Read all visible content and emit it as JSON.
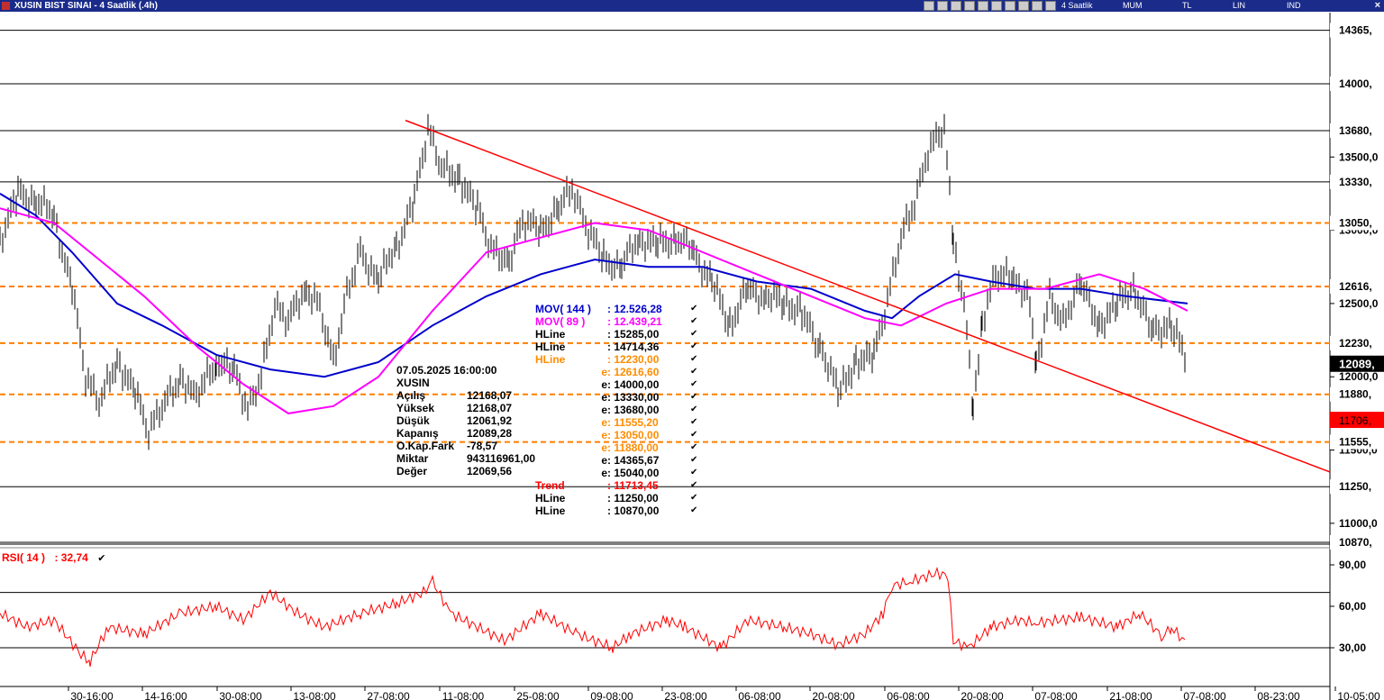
{
  "window": {
    "title": "XUSIN BIST SINAI - 4 Saatlik (.4h)",
    "toolbar_modes": [
      "4 Saatlik",
      "MUM",
      "TL",
      "LIN",
      "IND"
    ],
    "close_glyph": "×"
  },
  "price_axis": {
    "ticks": [
      "13500,0",
      "13000,0",
      "12500,0",
      "12000,0",
      "11500,0",
      "11000,0"
    ],
    "hline_labels": [
      {
        "text": "14365,",
        "value": 14365,
        "color": "#000000",
        "style": "solid"
      },
      {
        "text": "14000,",
        "value": 14000,
        "color": "#000000",
        "style": "solid"
      },
      {
        "text": "13680,",
        "value": 13680,
        "color": "#000000",
        "style": "solid"
      },
      {
        "text": "13330,",
        "value": 13330,
        "color": "#000000",
        "style": "solid"
      },
      {
        "text": "13050,",
        "value": 13050,
        "color": "#ff7f00",
        "style": "dashed"
      },
      {
        "text": "12616,",
        "value": 12616,
        "color": "#ff7f00",
        "style": "dashed"
      },
      {
        "text": "12230,",
        "value": 12230,
        "color": "#ff7f00",
        "style": "dashed"
      },
      {
        "text": "11880,",
        "value": 11880,
        "color": "#ff7f00",
        "style": "dashed"
      },
      {
        "text": "11555,",
        "value": 11555,
        "color": "#ff7f00",
        "style": "dashed"
      },
      {
        "text": "11250,",
        "value": 11250,
        "color": "#000000",
        "style": "solid"
      },
      {
        "text": "10870,",
        "value": 10870,
        "color": "#000000",
        "style": "solid"
      }
    ],
    "last_price": {
      "text": "12089,",
      "value": 12089
    },
    "trend_price": {
      "text": "11706,",
      "value": 11706
    }
  },
  "rsi_axis": {
    "ticks": [
      "90,00",
      "60,00",
      "30,00"
    ]
  },
  "time_axis": [
    "30-16:00",
    "14-16:00",
    "30-08:00",
    "13-08:00",
    "27-08:00",
    "11-08:00",
    "25-08:00",
    "09-08:00",
    "23-08:00",
    "06-08:00",
    "20-08:00",
    "06-08:00",
    "20-08:00",
    "07-08:00",
    "21-08:00",
    "07-08:00",
    "08-23:00",
    "10-05:00"
  ],
  "info_box": {
    "date": "07.05.2025  16:00:00",
    "symbol": "XUSIN",
    "rows": [
      {
        "k": "Açılış",
        "v": "12168,07"
      },
      {
        "k": "Yüksek",
        "v": "12168,07"
      },
      {
        "k": "Düşük",
        "v": "12061,92"
      },
      {
        "k": "Kapanış",
        "v": "12089,28"
      },
      {
        "k": "O.Kap.Fark",
        "v": "-78,57"
      },
      {
        "k": "Miktar",
        "v": "943116961,00"
      },
      {
        "k": "Değer",
        "v": "12069,56"
      }
    ]
  },
  "indicator_legend": [
    {
      "name": "MOV( 144 )",
      "value": ": 12.526,28",
      "color": "#0000cc"
    },
    {
      "name": "MOV( 89 )",
      "value": ": 12.439,21",
      "color": "#ff00ff"
    },
    {
      "name": "HLine",
      "value": ": 15285,00",
      "color": "#000000"
    },
    {
      "name": "HLine",
      "value": ": 14714,36",
      "color": "#000000"
    },
    {
      "name": "HLine",
      "value": ": 12230,00",
      "color": "#ff8c00"
    },
    {
      "name": "e",
      "value": ": 12616,60",
      "color": "#ff8c00"
    },
    {
      "name": "e",
      "value": ": 14000,00",
      "color": "#000000"
    },
    {
      "name": "e",
      "value": ": 13330,00",
      "color": "#000000"
    },
    {
      "name": "e",
      "value": ": 13680,00",
      "color": "#000000"
    },
    {
      "name": "e",
      "value": ": 11555,20",
      "color": "#ff8c00"
    },
    {
      "name": "e",
      "value": ": 13050,00",
      "color": "#ff8c00"
    },
    {
      "name": "e",
      "value": ": 11880,00",
      "color": "#ff8c00"
    },
    {
      "name": "e",
      "value": ": 14365,67",
      "color": "#000000"
    },
    {
      "name": "e",
      "value": ": 15040,00",
      "color": "#000000"
    },
    {
      "name": "Trend",
      "value": ": 11713,45",
      "color": "#ff0000"
    },
    {
      "name": "HLine",
      "value": ": 11250,00",
      "color": "#000000"
    },
    {
      "name": "HLine",
      "value": ": 10870,00",
      "color": "#000000"
    }
  ],
  "rsi_legend": {
    "label": "RSI( 14 )",
    "value": ": 32,74",
    "color": "#ff0000"
  },
  "colors": {
    "mov144": "#0000cc",
    "mov89": "#ff00ff",
    "trend": "#ff0000",
    "rsi": "#ff0000",
    "candle": "#000000"
  },
  "chart_data": {
    "type": "line",
    "price_points": [
      [
        0,
        12950
      ],
      [
        20,
        13250
      ],
      [
        40,
        13200
      ],
      [
        60,
        13100
      ],
      [
        80,
        12600
      ],
      [
        95,
        12000
      ],
      [
        110,
        11850
      ],
      [
        130,
        12100
      ],
      [
        150,
        11900
      ],
      [
        165,
        11600
      ],
      [
        180,
        11800
      ],
      [
        200,
        12000
      ],
      [
        215,
        11850
      ],
      [
        240,
        12100
      ],
      [
        260,
        12050
      ],
      [
        275,
        11750
      ],
      [
        290,
        12000
      ],
      [
        305,
        12500
      ],
      [
        320,
        12400
      ],
      [
        340,
        12600
      ],
      [
        355,
        12500
      ],
      [
        370,
        12100
      ],
      [
        385,
        12550
      ],
      [
        400,
        12850
      ],
      [
        420,
        12650
      ],
      [
        440,
        12900
      ],
      [
        460,
        13200
      ],
      [
        475,
        13700
      ],
      [
        490,
        13450
      ],
      [
        510,
        13350
      ],
      [
        530,
        13150
      ],
      [
        545,
        12850
      ],
      [
        565,
        12800
      ],
      [
        580,
        13050
      ],
      [
        600,
        13000
      ],
      [
        620,
        13150
      ],
      [
        635,
        13300
      ],
      [
        650,
        13050
      ],
      [
        670,
        12800
      ],
      [
        690,
        12750
      ],
      [
        710,
        12950
      ],
      [
        730,
        12900
      ],
      [
        750,
        12950
      ],
      [
        770,
        12850
      ],
      [
        790,
        12650
      ],
      [
        810,
        12350
      ],
      [
        830,
        12600
      ],
      [
        850,
        12550
      ],
      [
        870,
        12500
      ],
      [
        890,
        12450
      ],
      [
        910,
        12200
      ],
      [
        930,
        11900
      ],
      [
        950,
        12100
      ],
      [
        970,
        12150
      ],
      [
        985,
        12500
      ],
      [
        1000,
        12950
      ],
      [
        1015,
        13200
      ],
      [
        1030,
        13550
      ],
      [
        1048,
        13700
      ],
      [
        1058,
        12900
      ],
      [
        1070,
        12500
      ],
      [
        1080,
        11750
      ],
      [
        1090,
        12400
      ],
      [
        1105,
        12700
      ],
      [
        1125,
        12650
      ],
      [
        1140,
        12600
      ],
      [
        1150,
        12100
      ],
      [
        1165,
        12550
      ],
      [
        1180,
        12350
      ],
      [
        1200,
        12650
      ],
      [
        1220,
        12350
      ],
      [
        1240,
        12500
      ],
      [
        1260,
        12600
      ],
      [
        1280,
        12300
      ],
      [
        1300,
        12350
      ],
      [
        1318,
        12100
      ]
    ],
    "mov144_points": [
      [
        0,
        13250
      ],
      [
        40,
        13100
      ],
      [
        80,
        12850
      ],
      [
        130,
        12500
      ],
      [
        180,
        12350
      ],
      [
        240,
        12150
      ],
      [
        300,
        12050
      ],
      [
        360,
        12000
      ],
      [
        420,
        12100
      ],
      [
        480,
        12350
      ],
      [
        540,
        12550
      ],
      [
        600,
        12700
      ],
      [
        660,
        12800
      ],
      [
        720,
        12750
      ],
      [
        780,
        12750
      ],
      [
        840,
        12650
      ],
      [
        900,
        12600
      ],
      [
        960,
        12450
      ],
      [
        990,
        12400
      ],
      [
        1020,
        12550
      ],
      [
        1060,
        12700
      ],
      [
        1100,
        12650
      ],
      [
        1150,
        12600
      ],
      [
        1200,
        12600
      ],
      [
        1250,
        12550
      ],
      [
        1318,
        12500
      ]
    ],
    "mov89_points": [
      [
        0,
        13150
      ],
      [
        60,
        13050
      ],
      [
        100,
        12850
      ],
      [
        160,
        12550
      ],
      [
        220,
        12200
      ],
      [
        270,
        11950
      ],
      [
        320,
        11750
      ],
      [
        370,
        11800
      ],
      [
        420,
        12000
      ],
      [
        480,
        12450
      ],
      [
        540,
        12850
      ],
      [
        600,
        12950
      ],
      [
        660,
        13050
      ],
      [
        720,
        13000
      ],
      [
        780,
        12850
      ],
      [
        840,
        12700
      ],
      [
        900,
        12550
      ],
      [
        960,
        12400
      ],
      [
        1000,
        12350
      ],
      [
        1050,
        12500
      ],
      [
        1100,
        12600
      ],
      [
        1160,
        12600
      ],
      [
        1220,
        12700
      ],
      [
        1270,
        12600
      ],
      [
        1318,
        12450
      ]
    ],
    "trend_line": [
      [
        450,
        13750
      ],
      [
        1476,
        11350
      ]
    ],
    "rsi_points": [
      [
        0,
        55
      ],
      [
        30,
        45
      ],
      [
        60,
        50
      ],
      [
        90,
        25
      ],
      [
        100,
        20
      ],
      [
        120,
        45
      ],
      [
        160,
        40
      ],
      [
        200,
        55
      ],
      [
        240,
        60
      ],
      [
        270,
        50
      ],
      [
        300,
        70
      ],
      [
        330,
        55
      ],
      [
        360,
        45
      ],
      [
        400,
        55
      ],
      [
        440,
        62
      ],
      [
        470,
        70
      ],
      [
        480,
        78
      ],
      [
        500,
        55
      ],
      [
        530,
        45
      ],
      [
        560,
        35
      ],
      [
        600,
        55
      ],
      [
        640,
        40
      ],
      [
        680,
        30
      ],
      [
        700,
        40
      ],
      [
        740,
        50
      ],
      [
        760,
        45
      ],
      [
        800,
        30
      ],
      [
        830,
        50
      ],
      [
        870,
        45
      ],
      [
        900,
        40
      ],
      [
        930,
        32
      ],
      [
        960,
        40
      ],
      [
        980,
        55
      ],
      [
        990,
        75
      ],
      [
        1010,
        78
      ],
      [
        1040,
        84
      ],
      [
        1052,
        82
      ],
      [
        1058,
        35
      ],
      [
        1075,
        30
      ],
      [
        1100,
        45
      ],
      [
        1130,
        50
      ],
      [
        1150,
        48
      ],
      [
        1200,
        52
      ],
      [
        1240,
        45
      ],
      [
        1265,
        55
      ],
      [
        1290,
        38
      ],
      [
        1300,
        45
      ],
      [
        1318,
        32
      ]
    ],
    "y_axis_price": [
      10870,
      14365
    ],
    "y_axis_rsi": [
      20,
      90
    ]
  }
}
